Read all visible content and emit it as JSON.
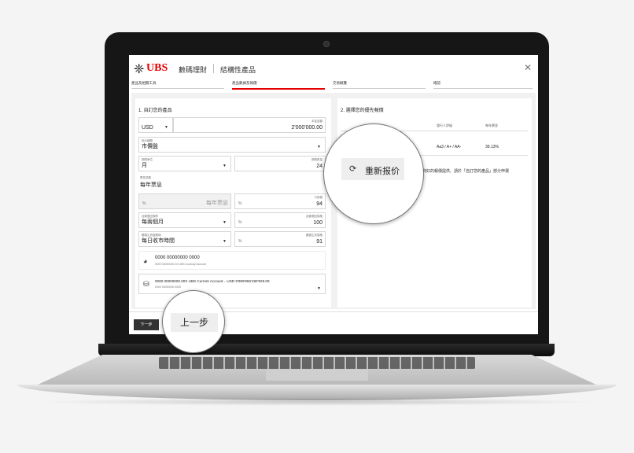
{
  "brand": {
    "logo_glyph": "❈",
    "logo_text": "UBS",
    "app_title": "數碼理財",
    "app_subtitle": "結構性產品",
    "close_icon": "close-icon"
  },
  "steps": [
    {
      "label": "產品及相關工具",
      "active": false
    },
    {
      "label": "產品數據及報價",
      "active": true
    },
    {
      "label": "交易概覽",
      "active": false
    },
    {
      "label": "確認",
      "active": false
    }
  ],
  "left": {
    "heading": "1. 自訂您的產品",
    "currency": "USD",
    "amount_label": "本金金額",
    "amount": "2'000'000.00",
    "underlying_label": "指示種類",
    "underlying": "市價盤",
    "period_unit_label": "期限單位",
    "period_unit": "月",
    "period_qty_label": "期限數量",
    "period_qty": "24",
    "coupon_freq_label": "票息週期",
    "coupon_freq": "每年票息",
    "coupon_pct_placeholder": "%",
    "coupon_pct_hint": "每年票息",
    "strike_label": "行使價",
    "strike_pct": "%",
    "strike_value": "94",
    "autocall_label": "自動贖回頻率",
    "autocall": "每兩個月",
    "autocall_level_label": "自動贖回價格",
    "autocall_level_pct": "%",
    "autocall_level": "100",
    "barrier_label": "觸價生效觀察期",
    "barrier": "每日收市時間",
    "barrier_level_label": "觸價生效價格",
    "barrier_level_pct": "%",
    "barrier_level": "91",
    "custody_number": "0000 00000000 0000",
    "custody_desc": "0000 00000000.X0 UBS Custody Account",
    "cash_text": "0000 00000000.00X  UBS Current Account...  USD 9'999'996'490'929.09",
    "cash_sub": "0000 00000000 0000"
  },
  "right": {
    "heading": "2. 選擇您的優先報價",
    "col_issuer_rating": "發行人評級",
    "col_coupon": "每年票息",
    "rating": "Aa3 / A+ / AA-",
    "coupon": "39.13%",
    "note": "商好的報價提供。請於「自訂您的產品」部分申選"
  },
  "footer": {
    "back_small": "下一步"
  },
  "magnifier": {
    "refresh_label": "重新报价",
    "back_label": "上一步"
  }
}
